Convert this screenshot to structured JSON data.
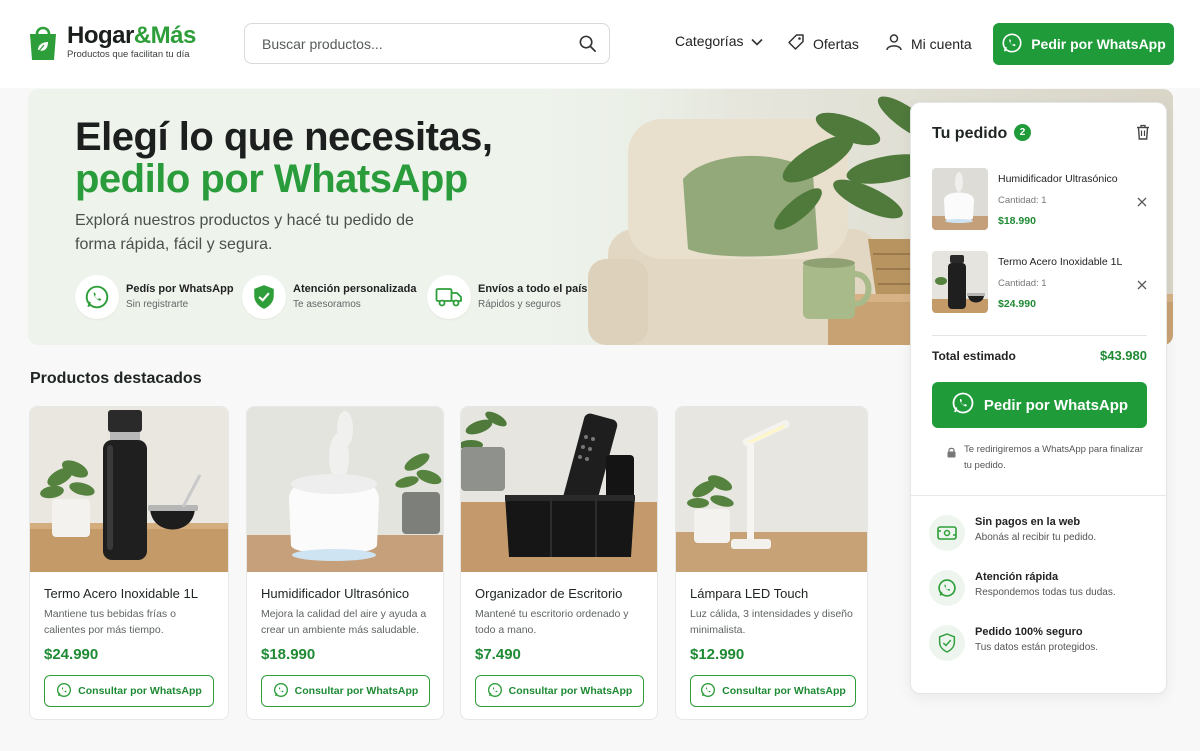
{
  "brand": {
    "name_part1": "Hogar",
    "name_part2": "&Más",
    "tagline": "Productos que facilitan tu día",
    "accent_color": "#1f9b3a"
  },
  "search": {
    "placeholder": "Buscar productos..."
  },
  "nav": {
    "categorias": "Categorías",
    "ofertas": "Ofertas",
    "mi_cuenta": "Mi cuenta",
    "whatsapp_button": "Pedir por WhatsApp"
  },
  "hero": {
    "title_line1": "Elegí lo que necesitas,",
    "title_line2": "pedilo por WhatsApp",
    "subtitle": "Explorá nuestros productos y hacé tu pedido de forma rápida, fácil y segura.",
    "features": [
      {
        "title": "Pedís por WhatsApp",
        "subtitle": "Sin registrarte",
        "icon": "whatsapp-icon"
      },
      {
        "title": "Atención personalizada",
        "subtitle": "Te asesoramos",
        "icon": "shield-check-icon"
      },
      {
        "title": "Envíos a todo el país",
        "subtitle": "Rápidos y seguros",
        "icon": "truck-icon"
      }
    ]
  },
  "products": {
    "section_title": "Productos destacados",
    "button_label": "Consultar por WhatsApp",
    "items": [
      {
        "name": "Termo Acero Inoxidable 1L",
        "description": "Mantiene tus bebidas frías o calientes por más tiempo.",
        "price": "$24.990"
      },
      {
        "name": "Humidificador Ultrasónico",
        "description": "Mejora la calidad del aire y ayuda a crear un ambiente más saludable.",
        "price": "$18.990"
      },
      {
        "name": "Organizador de Escritorio",
        "description": "Mantené tu escritorio ordenado y todo a mano.",
        "price": "$7.490"
      },
      {
        "name": "Lámpara LED Touch",
        "description": "Luz cálida, 3 intensidades y diseño minimalista.",
        "price": "$12.990"
      }
    ]
  },
  "cart": {
    "title": "Tu pedido",
    "count": "2",
    "items": [
      {
        "name": "Humidificador Ultrasónico",
        "quantity": "Cantidad: 1",
        "price": "$18.990"
      },
      {
        "name": "Termo Acero Inoxidable 1L",
        "quantity": "Cantidad: 1",
        "price": "$24.990"
      }
    ],
    "total_label": "Total estimado",
    "total_value": "$43.980",
    "button_label": "Pedir por WhatsApp",
    "note": "Te redirigiremos a WhatsApp para finalizar tu pedido.",
    "guarantees": [
      {
        "title": "Sin pagos en la web",
        "subtitle": "Abonás al recibir tu pedido.",
        "icon": "cash-icon"
      },
      {
        "title": "Atención rápida",
        "subtitle": "Respondemos todas tus dudas.",
        "icon": "whatsapp-icon"
      },
      {
        "title": "Pedido 100% seguro",
        "subtitle": "Tus datos están protegidos.",
        "icon": "shield-check-icon"
      }
    ]
  }
}
